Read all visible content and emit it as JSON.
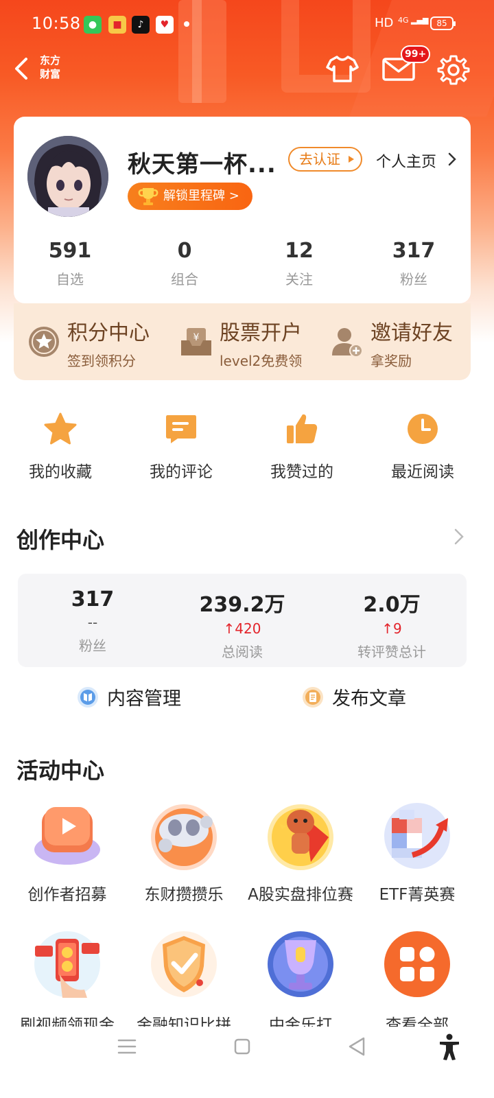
{
  "status_bar": {
    "time": "10:58",
    "network": "HD",
    "signal_label": "4G",
    "battery": "85"
  },
  "header": {
    "brand_line1": "东方",
    "brand_line2": "财富",
    "mail_badge": "99+"
  },
  "profile": {
    "nickname": "秋天第一杯...",
    "verify_label": "去认证",
    "homepage_label": "个人主页",
    "milestone_label": "解锁里程碑 >",
    "stats": [
      {
        "value": "591",
        "label": "自选"
      },
      {
        "value": "0",
        "label": "组合"
      },
      {
        "value": "12",
        "label": "关注"
      },
      {
        "value": "317",
        "label": "粉丝"
      }
    ]
  },
  "benefits": [
    {
      "title": "积分中心",
      "subtitle": "签到领积分",
      "icon": "points-star-icon"
    },
    {
      "title": "股票开户",
      "subtitle": "level2免费领",
      "icon": "account-open-icon"
    },
    {
      "title": "邀请好友",
      "subtitle": "拿奖励",
      "icon": "invite-friend-icon"
    }
  ],
  "quick_actions": [
    {
      "label": "我的收藏",
      "icon": "star-icon"
    },
    {
      "label": "我的评论",
      "icon": "comment-icon"
    },
    {
      "label": "我赞过的",
      "icon": "thumbs-up-icon"
    },
    {
      "label": "最近阅读",
      "icon": "clock-icon"
    }
  ],
  "creation_center": {
    "title": "创作中心",
    "stats": [
      {
        "value": "317",
        "delta": "--",
        "label": "粉丝"
      },
      {
        "value": "239.2万",
        "delta": "420",
        "label": "总阅读"
      },
      {
        "value": "2.0万",
        "delta": "9",
        "label": "转评赞总计"
      }
    ],
    "actions": [
      {
        "label": "内容管理",
        "icon": "content-manage-icon"
      },
      {
        "label": "发布文章",
        "icon": "publish-article-icon"
      }
    ]
  },
  "activity_center": {
    "title": "活动中心",
    "items": [
      {
        "label": "创作者招募"
      },
      {
        "label": "东财攒攒乐"
      },
      {
        "label": "A股实盘排位赛"
      },
      {
        "label": "ETF菁英赛"
      },
      {
        "label": "刷视频领现金"
      },
      {
        "label": "金融知识比拼"
      },
      {
        "label": "中金乐打"
      },
      {
        "label": "查看全部"
      }
    ]
  },
  "colors": {
    "brand_orange": "#f85a25",
    "accent_orange": "#f5a340",
    "delta_red": "#e3242b",
    "benefit_bg": "#fbe9d8"
  }
}
